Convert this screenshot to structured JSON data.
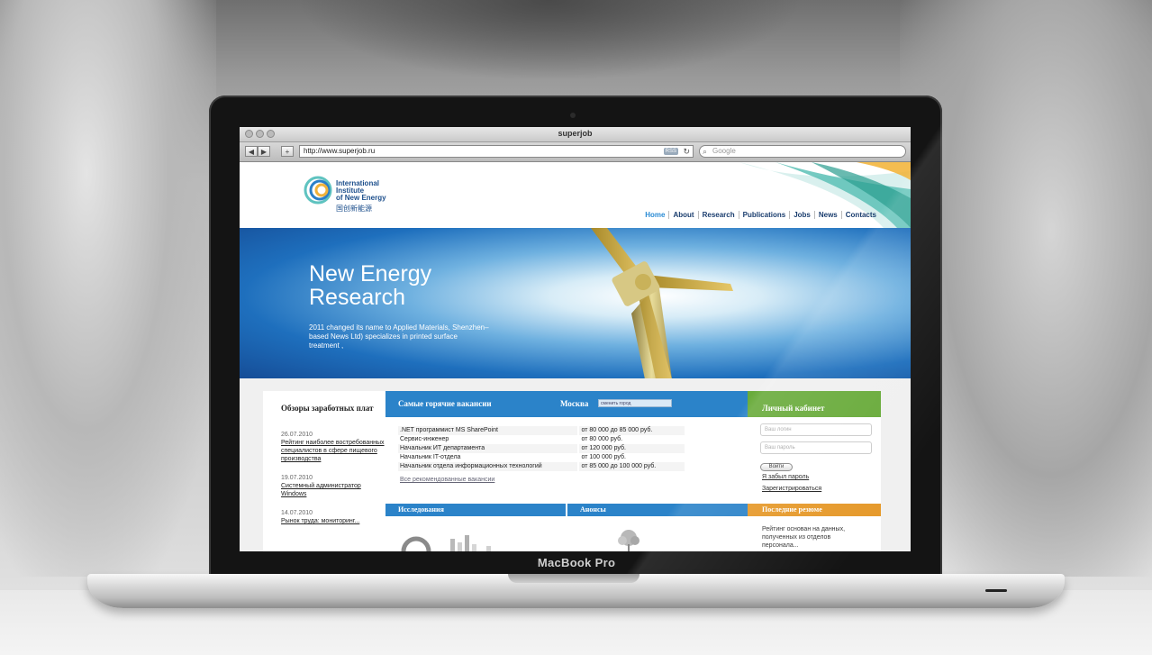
{
  "device": {
    "brand_label": "MacBook Pro"
  },
  "browser": {
    "window_title": "superjob",
    "url": "http://www.superjob.ru",
    "rss_badge": "RSS",
    "reload_icon": "reload-icon",
    "search_placeholder": "Google",
    "back_icon": "◀",
    "forward_icon": "▶",
    "add_icon": "+"
  },
  "site": {
    "logo": {
      "line1": "International",
      "line2": "Institute",
      "line3": "of New Energy",
      "cn": "国创新能源"
    },
    "nav": [
      "Home",
      "About",
      "Research",
      "Publications",
      "Jobs",
      "News",
      "Contacts"
    ],
    "hero": {
      "title_line1": "New Energy",
      "title_line2": "Research",
      "description": "2011 changed its name to Applied Materials, Shenzhen–based News Ltd) specializes in printed surface treatment ,"
    }
  },
  "superjob": {
    "left": {
      "heading": "Обзоры заработных плат",
      "news": [
        {
          "date": "26.07.2010",
          "title": "Рейтинг наиболее востребованных специалистов в сфере пищевого производства"
        },
        {
          "date": "19.07.2010",
          "title": "Системный администратор Windows"
        },
        {
          "date": "14.07.2010",
          "title": "Рынок труда: мониторинг..."
        }
      ]
    },
    "middle": {
      "heading": "Самые горячие вакансии",
      "city": "Москва",
      "city_select": "сменить город",
      "vacancies": [
        {
          "title": ".NET программист MS SharePoint",
          "salary": "от 80 000 до 85 000 руб."
        },
        {
          "title": "Сервис-инженер",
          "salary": "от 80 000 руб."
        },
        {
          "title": "Начальник ИТ департамента",
          "salary": "от 120 000 руб."
        },
        {
          "title": "Начальник IT-отдела",
          "salary": "от 100 000 руб."
        },
        {
          "title": "Начальник отдела информационных технологий",
          "salary": "от 85 000 до 100 000 руб."
        }
      ],
      "all_link": "Все рекомендованные вакансии",
      "sub_left": "Исследования",
      "sub_right": "Анонсы"
    },
    "right": {
      "heading": "Личный кабинет",
      "login_placeholder": "Ваш логин",
      "password_placeholder": "Ваш пароль",
      "login_button": "Войти",
      "forgot": "Я забыл пароль",
      "register": "Зарегистрироваться",
      "resume_heading": "Последние резюме",
      "resume_text": "Рейтинг основан на данных, полученных из отделов персонала..."
    }
  },
  "colors": {
    "blue": "#2b83c9",
    "green": "#69ab3b",
    "orange": "#e69a2c",
    "nav_active": "#2a8bd4"
  }
}
